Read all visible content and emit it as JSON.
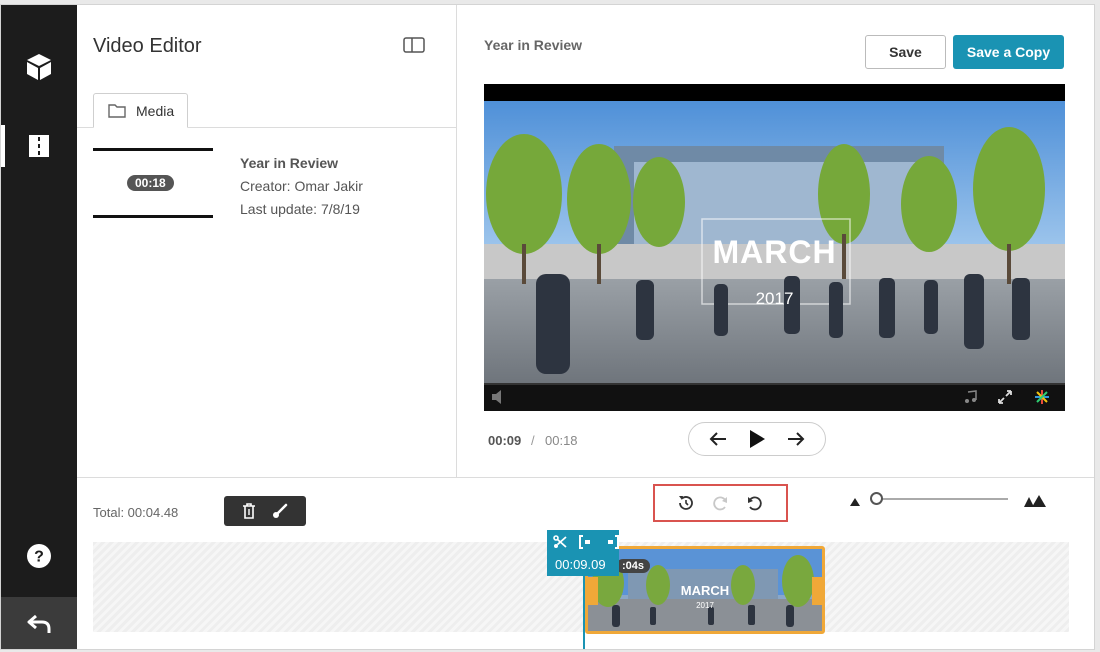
{
  "sidebar": {
    "items": [
      {
        "icon": "cube-icon",
        "label": ""
      },
      {
        "icon": "editor-icon",
        "label": ""
      }
    ],
    "help_icon": "help-icon",
    "back_icon": "back-arrow-icon"
  },
  "panel": {
    "title": "Video Editor",
    "tabs": [
      {
        "label": "Media",
        "icon": "folder-icon"
      }
    ],
    "media": [
      {
        "duration": "00:18",
        "title": "Year in Review",
        "creator": "Creator: Omar Jakir",
        "updated": "Last update: 7/8/19"
      }
    ]
  },
  "preview": {
    "title": "Year in Review",
    "save_label": "Save",
    "save_copy_label": "Save a Copy",
    "overlay_title": "MARCH",
    "overlay_year": "2017",
    "current_time": "00:09",
    "separator": "/",
    "duration": "00:18"
  },
  "timeline": {
    "total": "Total: 00:04.48",
    "playhead_time": "00:09.09",
    "clip_duration": ":04s",
    "clip_title": "MARCH",
    "clip_year": "2017"
  },
  "colors": {
    "accent": "#1a93b3",
    "clip_border": "#f0a838",
    "highlight": "#d9534f",
    "rail": "#1c1c1c"
  }
}
